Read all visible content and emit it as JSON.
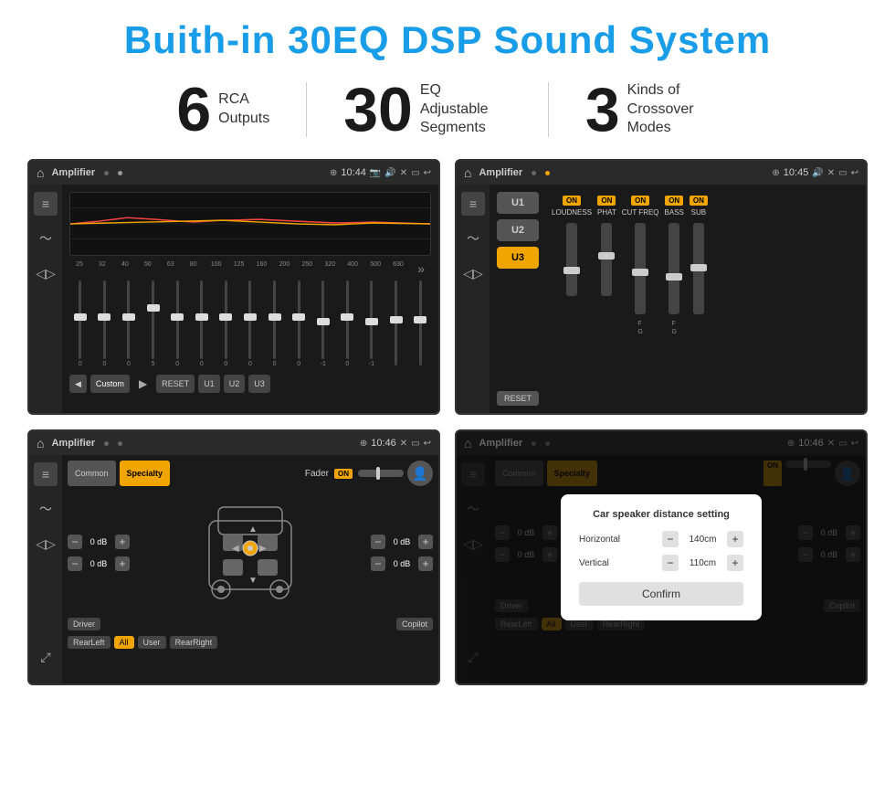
{
  "title": "Buith-in 30EQ DSP Sound System",
  "stats": [
    {
      "number": "6",
      "label": "RCA\nOutputs"
    },
    {
      "number": "30",
      "label": "EQ Adjustable\nSegments"
    },
    {
      "number": "3",
      "label": "Kinds of\nCrossover Modes"
    }
  ],
  "screens": [
    {
      "id": "eq-screen",
      "topbar": {
        "time": "10:44",
        "title": "Amplifier"
      },
      "type": "eq"
    },
    {
      "id": "amp-screen",
      "topbar": {
        "time": "10:45",
        "title": "Amplifier"
      },
      "type": "amp"
    },
    {
      "id": "fader-screen",
      "topbar": {
        "time": "10:46",
        "title": "Amplifier"
      },
      "type": "fader"
    },
    {
      "id": "dialog-screen",
      "topbar": {
        "time": "10:46",
        "title": "Amplifier"
      },
      "type": "dialog"
    }
  ],
  "eq": {
    "freqs": [
      "25",
      "32",
      "40",
      "50",
      "63",
      "80",
      "100",
      "125",
      "160",
      "200",
      "250",
      "320",
      "400",
      "500",
      "630"
    ],
    "values": [
      "0",
      "0",
      "0",
      "5",
      "0",
      "0",
      "0",
      "0",
      "0",
      "0",
      "-1",
      "0",
      "-1",
      "",
      ""
    ],
    "buttons": [
      "Custom",
      "RESET",
      "U1",
      "U2",
      "U3"
    ]
  },
  "amp": {
    "u_buttons": [
      "U1",
      "U2",
      "U3"
    ],
    "channels": [
      {
        "label": "LOUDNESS",
        "on": true
      },
      {
        "label": "PHAT",
        "on": true
      },
      {
        "label": "CUT FREQ",
        "on": true
      },
      {
        "label": "BASS",
        "on": true
      },
      {
        "label": "SUB",
        "on": true
      }
    ]
  },
  "fader": {
    "tabs": [
      "Common",
      "Specialty"
    ],
    "fader_label": "Fader",
    "fader_on": "ON",
    "volumes": [
      "0 dB",
      "0 dB",
      "0 dB",
      "0 dB"
    ],
    "bottom_labels": [
      "Driver",
      "",
      "Copilot",
      "RearLeft",
      "All",
      "User",
      "RearRight"
    ]
  },
  "dialog": {
    "title": "Car speaker distance setting",
    "horizontal_label": "Horizontal",
    "horizontal_value": "140cm",
    "vertical_label": "Vertical",
    "vertical_value": "110cm",
    "confirm_label": "Confirm",
    "tabs": [
      "Common",
      "Specialty"
    ],
    "fader_on": "ON",
    "volumes": [
      "0 dB",
      "0 dB"
    ],
    "bottom_labels": [
      "Driver",
      "",
      "Copilot",
      "RearLeft",
      "All",
      "User",
      "RearRight"
    ]
  }
}
